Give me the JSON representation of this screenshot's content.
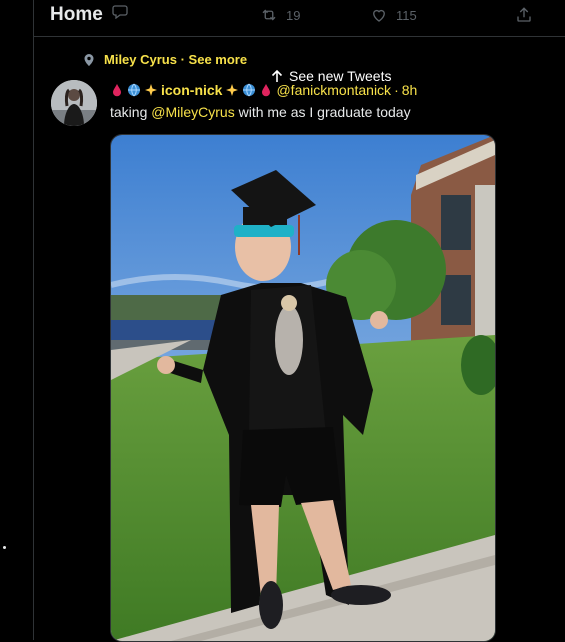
{
  "header": {
    "title": "Home",
    "retweet_count": "19",
    "like_count": "115"
  },
  "context": {
    "label": "Miley Cyrus",
    "separator": " · ",
    "see_more": "See more"
  },
  "new_tweets": {
    "label": "See new Tweets"
  },
  "tweet": {
    "display_name": "icon-nick",
    "handle": "@fanickmontanick",
    "separator": " · ",
    "time": "8h",
    "text_before": "taking ",
    "mention": "@MileyCyrus",
    "text_after": " with me as I graduate today"
  },
  "colors": {
    "accent": "#f7e14a",
    "background": "#000000",
    "border": "#2f3336",
    "muted": "#5b6167"
  },
  "icons": [
    "comment-icon",
    "retweet-icon",
    "like-icon",
    "share-icon",
    "topic-icon",
    "arrow-up-icon",
    "drop-emoji",
    "globe-emoji",
    "sparkles-emoji"
  ]
}
